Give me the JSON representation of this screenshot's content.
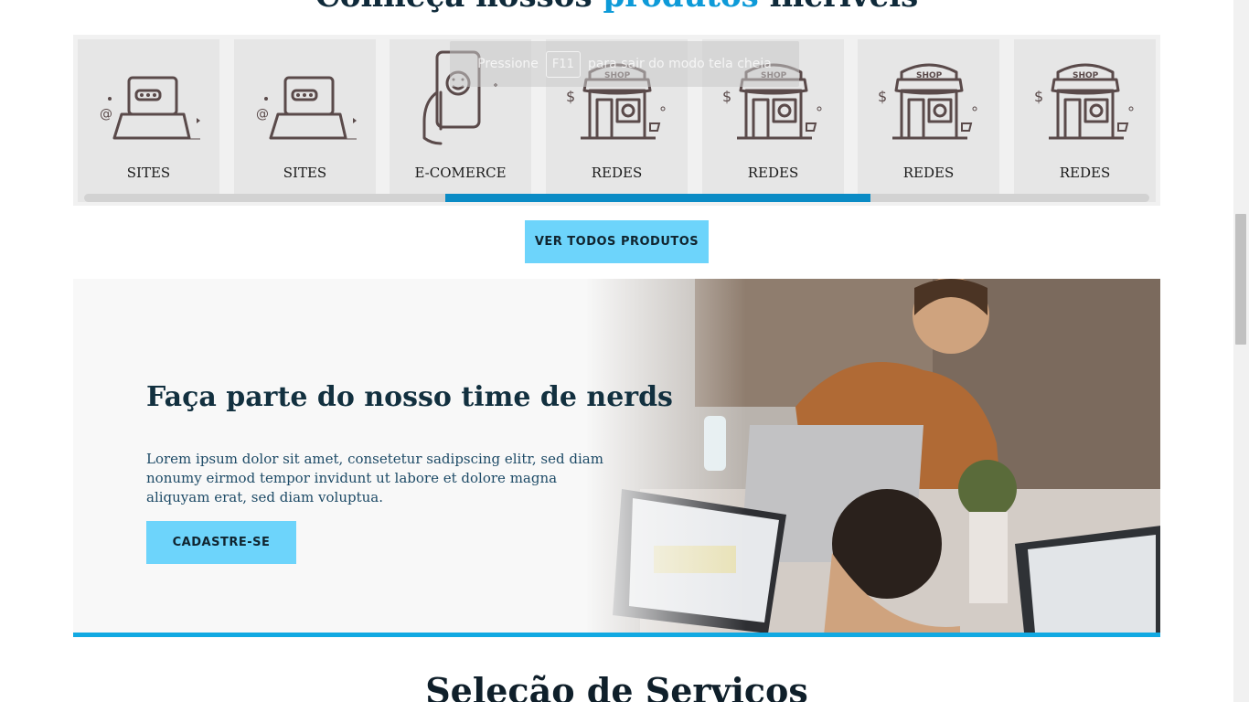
{
  "section_heading": {
    "text_dark": "Conheça nossos",
    "text_accent": "produtos",
    "text_dark_end": "incríveis"
  },
  "fullscreen_toast": {
    "prefix": "Pressione",
    "key": "F11",
    "suffix": "para sair do modo tela cheia"
  },
  "carousel": {
    "cards": [
      {
        "label": "SITES",
        "icon": "laptop-icon"
      },
      {
        "label": "SITES",
        "icon": "laptop-icon"
      },
      {
        "label": "E-COMERCE",
        "icon": "phone-hand-icon"
      },
      {
        "label": "REDES",
        "icon": "shop-icon"
      },
      {
        "label": "REDES",
        "icon": "shop-icon"
      },
      {
        "label": "REDES",
        "icon": "shop-icon"
      },
      {
        "label": "REDES",
        "icon": "shop-icon"
      }
    ],
    "shop_sign": "SHOP"
  },
  "buttons": {
    "all_products": "VER TODOS PRODUTOS",
    "signup": "CADASTRE-SE"
  },
  "hero": {
    "title": "Faça parte do nosso time de nerds",
    "text": "Lorem ipsum dolor sit amet, consetetur sadipscing elitr, sed diam nonumy eirmod tempor invidunt ut labore et dolore magna aliquyam erat, sed diam voluptua."
  },
  "next_section": {
    "title": "Seleção de Serviços"
  },
  "colors": {
    "accent": "#0d9ad8",
    "button": "#6dd4fb",
    "scrollbar_thumb": "#0a8bc5",
    "hero_line": "#11a9e2"
  }
}
